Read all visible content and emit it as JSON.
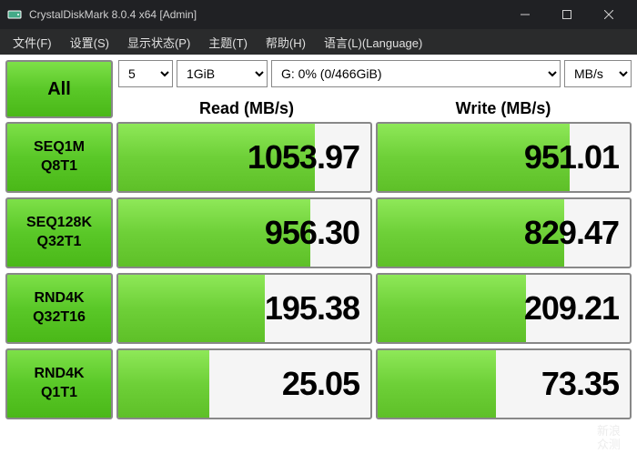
{
  "titlebar": {
    "title": "CrystalDiskMark 8.0.4 x64 [Admin]"
  },
  "menu": {
    "file": "文件(F)",
    "settings": "设置(S)",
    "display": "显示状态(P)",
    "theme": "主题(T)",
    "help": "帮助(H)",
    "language": "语言(L)(Language)"
  },
  "controls": {
    "all_label": "All",
    "count": "5",
    "size": "1GiB",
    "drive": "G: 0% (0/466GiB)",
    "unit": "MB/s"
  },
  "headers": {
    "read": "Read (MB/s)",
    "write": "Write (MB/s)"
  },
  "tests": [
    {
      "line1": "SEQ1M",
      "line2": "Q8T1",
      "read": "1053.97",
      "write": "951.01",
      "read_pct": 78,
      "write_pct": 76
    },
    {
      "line1": "SEQ128K",
      "line2": "Q32T1",
      "read": "956.30",
      "write": "829.47",
      "read_pct": 76,
      "write_pct": 74
    },
    {
      "line1": "RND4K",
      "line2": "Q32T16",
      "read": "195.38",
      "write": "209.21",
      "read_pct": 58,
      "write_pct": 59
    },
    {
      "line1": "RND4K",
      "line2": "Q1T1",
      "read": "25.05",
      "write": "73.35",
      "read_pct": 36,
      "write_pct": 47
    }
  ],
  "watermark": {
    "line1": "新浪",
    "line2": "众测"
  }
}
